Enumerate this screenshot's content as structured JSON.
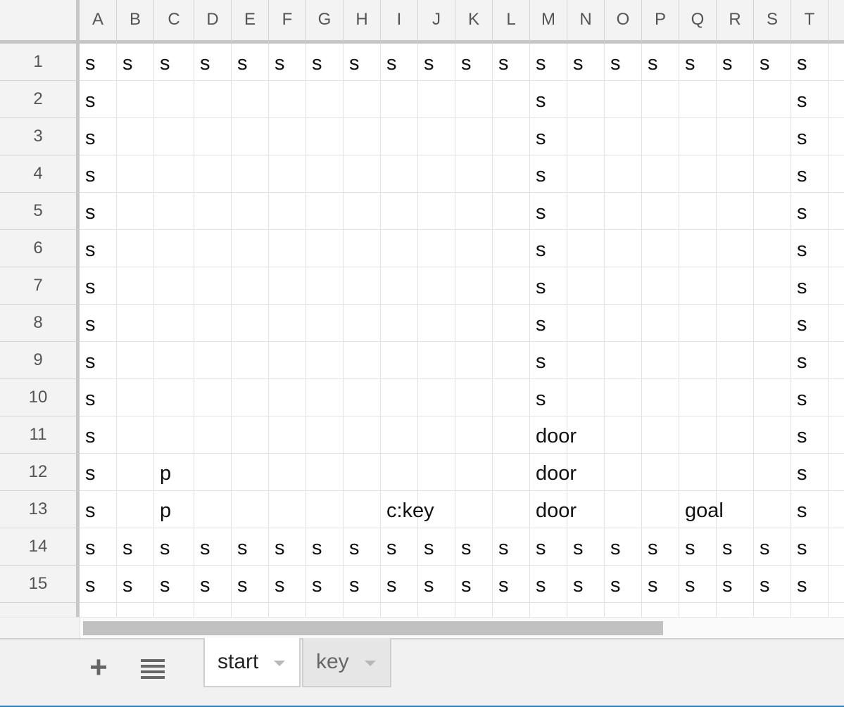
{
  "columns": [
    "A",
    "B",
    "C",
    "D",
    "E",
    "F",
    "G",
    "H",
    "I",
    "J",
    "K",
    "L",
    "M",
    "N",
    "O",
    "P",
    "Q",
    "R",
    "S",
    "T"
  ],
  "rows": [
    {
      "num": "1",
      "cells": [
        "s",
        "s",
        "s",
        "s",
        "s",
        "s",
        "s",
        "s",
        "s",
        "s",
        "s",
        "s",
        "s",
        "s",
        "s",
        "s",
        "s",
        "s",
        "s",
        "s"
      ]
    },
    {
      "num": "2",
      "cells": [
        "s",
        "",
        "",
        "",
        "",
        "",
        "",
        "",
        "",
        "",
        "",
        "",
        "s",
        "",
        "",
        "",
        "",
        "",
        "",
        "s"
      ]
    },
    {
      "num": "3",
      "cells": [
        "s",
        "",
        "",
        "",
        "",
        "",
        "",
        "",
        "",
        "",
        "",
        "",
        "s",
        "",
        "",
        "",
        "",
        "",
        "",
        "s"
      ]
    },
    {
      "num": "4",
      "cells": [
        "s",
        "",
        "",
        "",
        "",
        "",
        "",
        "",
        "",
        "",
        "",
        "",
        "s",
        "",
        "",
        "",
        "",
        "",
        "",
        "s"
      ]
    },
    {
      "num": "5",
      "cells": [
        "s",
        "",
        "",
        "",
        "",
        "",
        "",
        "",
        "",
        "",
        "",
        "",
        "s",
        "",
        "",
        "",
        "",
        "",
        "",
        "s"
      ]
    },
    {
      "num": "6",
      "cells": [
        "s",
        "",
        "",
        "",
        "",
        "",
        "",
        "",
        "",
        "",
        "",
        "",
        "s",
        "",
        "",
        "",
        "",
        "",
        "",
        "s"
      ]
    },
    {
      "num": "7",
      "cells": [
        "s",
        "",
        "",
        "",
        "",
        "",
        "",
        "",
        "",
        "",
        "",
        "",
        "s",
        "",
        "",
        "",
        "",
        "",
        "",
        "s"
      ]
    },
    {
      "num": "8",
      "cells": [
        "s",
        "",
        "",
        "",
        "",
        "",
        "",
        "",
        "",
        "",
        "",
        "",
        "s",
        "",
        "",
        "",
        "",
        "",
        "",
        "s"
      ]
    },
    {
      "num": "9",
      "cells": [
        "s",
        "",
        "",
        "",
        "",
        "",
        "",
        "",
        "",
        "",
        "",
        "",
        "s",
        "",
        "",
        "",
        "",
        "",
        "",
        "s"
      ]
    },
    {
      "num": "10",
      "cells": [
        "s",
        "",
        "",
        "",
        "",
        "",
        "",
        "",
        "",
        "",
        "",
        "",
        "s",
        "",
        "",
        "",
        "",
        "",
        "",
        "s"
      ]
    },
    {
      "num": "11",
      "cells": [
        "s",
        "",
        "",
        "",
        "",
        "",
        "",
        "",
        "",
        "",
        "",
        "",
        "door",
        "",
        "",
        "",
        "",
        "",
        "",
        "s"
      ]
    },
    {
      "num": "12",
      "cells": [
        "s",
        "",
        "p",
        "",
        "",
        "",
        "",
        "",
        "",
        "",
        "",
        "",
        "door",
        "",
        "",
        "",
        "",
        "",
        "",
        "s"
      ]
    },
    {
      "num": "13",
      "cells": [
        "s",
        "",
        "p",
        "",
        "",
        "",
        "",
        "",
        "c:key",
        "",
        "",
        "",
        "door",
        "",
        "",
        "",
        "goal",
        "",
        "",
        "s"
      ]
    },
    {
      "num": "14",
      "cells": [
        "s",
        "s",
        "s",
        "s",
        "s",
        "s",
        "s",
        "s",
        "s",
        "s",
        "s",
        "s",
        "s",
        "s",
        "s",
        "s",
        "s",
        "s",
        "s",
        "s"
      ]
    },
    {
      "num": "15",
      "cells": [
        "s",
        "s",
        "s",
        "s",
        "s",
        "s",
        "s",
        "s",
        "s",
        "s",
        "s",
        "s",
        "s",
        "s",
        "s",
        "s",
        "s",
        "s",
        "s",
        "s"
      ]
    }
  ],
  "sheet_tabs": [
    {
      "label": "start",
      "active": true
    },
    {
      "label": "key",
      "active": false
    }
  ],
  "icons": {
    "add_sheet": "plus-icon",
    "all_sheets": "list-icon",
    "tab_menu": "dropdown-arrow-icon"
  }
}
